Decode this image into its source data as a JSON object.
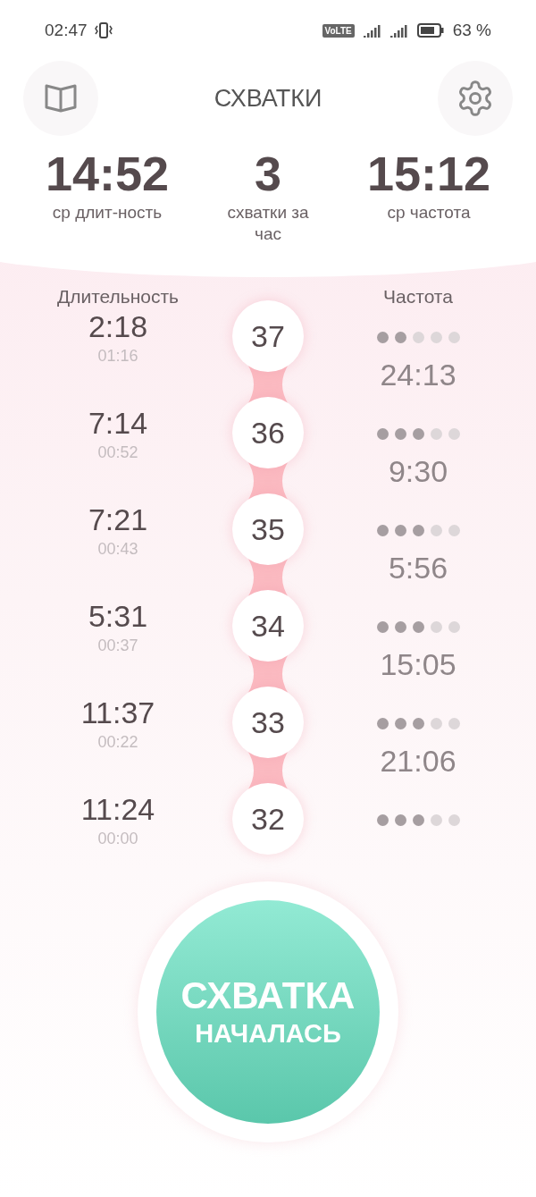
{
  "status_bar": {
    "time": "02:47",
    "network_badge": "VoLTE",
    "battery": "63 %"
  },
  "header": {
    "title": "СХВАТКИ"
  },
  "stats": [
    {
      "value": "14:52",
      "label": "ср длит-ность"
    },
    {
      "value": "3",
      "label": "схватки за час"
    },
    {
      "value": "15:12",
      "label": "ср частота"
    }
  ],
  "columns": {
    "left": "Длительность",
    "right": "Частота"
  },
  "rows": [
    {
      "duration": "2:18",
      "time": "01:16",
      "number": "37",
      "stars": 2,
      "frequency": "24:13"
    },
    {
      "duration": "7:14",
      "time": "00:52",
      "number": "36",
      "stars": 3,
      "frequency": "9:30"
    },
    {
      "duration": "7:21",
      "time": "00:43",
      "number": "35",
      "stars": 3,
      "frequency": "5:56"
    },
    {
      "duration": "5:31",
      "time": "00:37",
      "number": "34",
      "stars": 3,
      "frequency": "15:05"
    },
    {
      "duration": "11:37",
      "time": "00:22",
      "number": "33",
      "stars": 3,
      "frequency": "21:06"
    },
    {
      "duration": "11:24",
      "time": "00:00",
      "number": "32",
      "stars": 3
    }
  ],
  "start_button": {
    "lines": [
      "СХВАТКА",
      "НАЧАЛАСЬ"
    ]
  }
}
